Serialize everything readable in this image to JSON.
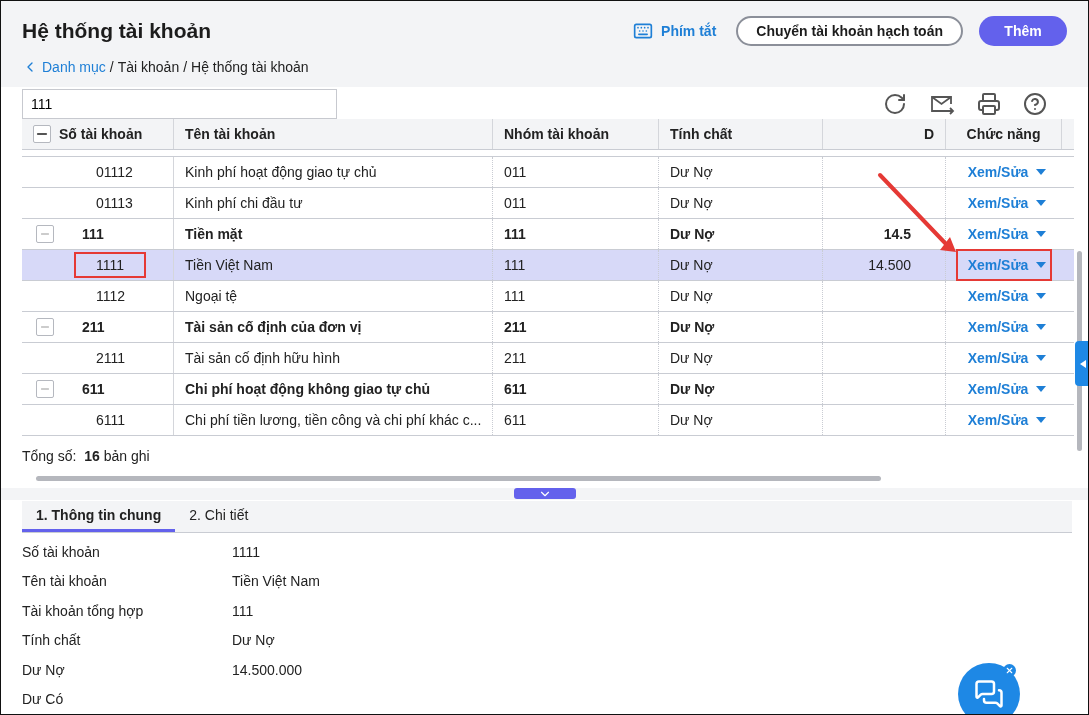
{
  "header": {
    "title": "Hệ thống tài khoản",
    "shortcut_label": "Phím tắt",
    "buttons": [
      {
        "label": "Chuyển tài khoản hạch toán",
        "kind": "outline"
      },
      {
        "label": "Thêm",
        "kind": "primary"
      }
    ]
  },
  "breadcrumb": [
    {
      "label": "Danh mục",
      "kind": "link"
    },
    {
      "label": "/",
      "kind": "separator"
    },
    {
      "label": "Tài khoản",
      "kind": "text"
    },
    {
      "label": "/",
      "kind": "separator"
    },
    {
      "label": "Hệ thống tài khoản",
      "kind": "text"
    }
  ],
  "search": {
    "value": "111"
  },
  "table": {
    "columns": [
      "Số tài khoản",
      "Tên tài khoản",
      "Nhóm tài khoản",
      "Tính chất",
      "D",
      "Chức năng"
    ],
    "annotation_arrow": true,
    "select_all_partial": true,
    "rows": [
      {
        "kind": "child",
        "code": "01112",
        "name": "Kinh phí hoạt động giao tự chủ",
        "group": "011",
        "nature": "Dư Nợ",
        "action": "Xem/Sửa",
        "selected": false,
        "annotated": false
      },
      {
        "kind": "child",
        "code": "01113",
        "name": "Kinh phí chi đầu tư",
        "group": "011",
        "nature": "Dư Nợ",
        "action": "Xem/Sửa",
        "selected": false,
        "annotated": false
      },
      {
        "kind": "group",
        "code": "111",
        "name": "Tiền mặt",
        "group": "111",
        "nature": "Dư Nợ",
        "column_5": "14.5",
        "action": "Xem/Sửa",
        "expanded": true,
        "selected": false,
        "annotated": false
      },
      {
        "kind": "child",
        "code": "1111",
        "name": "Tiền Việt Nam",
        "group": "111",
        "nature": "Dư Nợ",
        "column_5": "14.500",
        "action": "Xem/Sửa",
        "selected": true,
        "annotated": true
      },
      {
        "kind": "child",
        "code": "1112",
        "name": "Ngoại tệ",
        "group": "111",
        "nature": "Dư Nợ",
        "action": "Xem/Sửa",
        "selected": false,
        "annotated": false
      },
      {
        "kind": "group",
        "code": "211",
        "name": "Tài sản cố định của đơn vị",
        "group": "211",
        "nature": "Dư Nợ",
        "action": "Xem/Sửa",
        "expanded": true,
        "selected": false,
        "annotated": false
      },
      {
        "kind": "child",
        "code": "2111",
        "name": "Tài sản cố định hữu hình",
        "group": "211",
        "nature": "Dư Nợ",
        "action": "Xem/Sửa",
        "selected": false,
        "annotated": false
      },
      {
        "kind": "group",
        "code": "611",
        "name": "Chi phí hoạt động không giao tự chủ",
        "group": "611",
        "nature": "Dư Nợ",
        "action": "Xem/Sửa",
        "expanded": true,
        "selected": false,
        "annotated": false
      },
      {
        "kind": "child",
        "code": "6111",
        "name": "Chi phí tiền lương, tiền công và chi phí khác c...",
        "group": "611",
        "nature": "Dư Nợ",
        "action": "Xem/Sửa",
        "selected": false,
        "annotated": false
      }
    ]
  },
  "total": {
    "label": "Tổng số:",
    "count": "16",
    "unit": "bản ghi"
  },
  "detail": {
    "tabs": [
      {
        "label": "1. Thông tin chung",
        "selected": true
      },
      {
        "label": "2. Chi tiết",
        "selected": false
      }
    ],
    "fields": [
      {
        "label": "Số tài khoản",
        "value": "1111"
      },
      {
        "label": "Tên tài khoản",
        "value": "Tiền Việt Nam"
      },
      {
        "label": "Tài khoản tổng hợp",
        "value": "111"
      },
      {
        "label": "Tính chất",
        "value": "Dư Nợ"
      },
      {
        "label": "Dư Nợ",
        "value": "14.500.000"
      },
      {
        "label": "Dư Có"
      }
    ]
  }
}
